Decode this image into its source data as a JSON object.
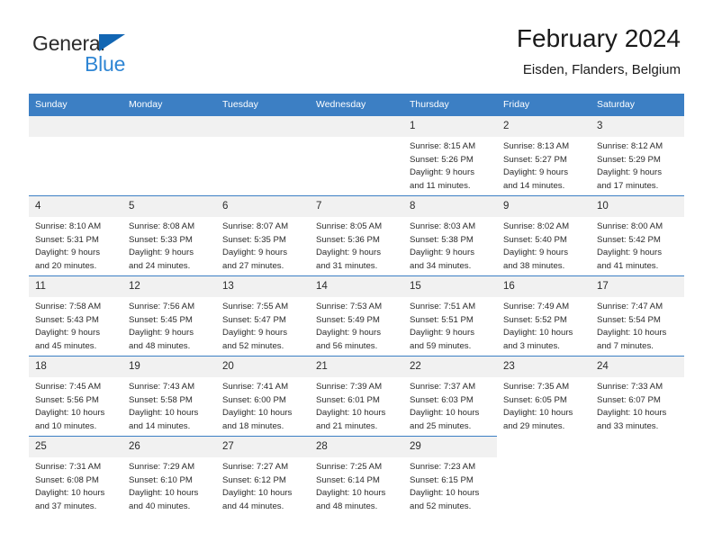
{
  "brand": {
    "line1": "General",
    "line2": "Blue",
    "triangle_icon": "blue-triangle-logo-mark",
    "accent_color": "#1266b3",
    "text_color": "#2f86d4"
  },
  "header": {
    "title": "February 2024",
    "subtitle": "Eisden, Flanders, Belgium"
  },
  "theme": {
    "header_row_bg": "#3c7fc4",
    "daynum_bg": "#f1f1f1",
    "text": "#2b2b2b"
  },
  "weekdays": [
    {
      "label": "Sunday"
    },
    {
      "label": "Monday"
    },
    {
      "label": "Tuesday"
    },
    {
      "label": "Wednesday"
    },
    {
      "label": "Thursday"
    },
    {
      "label": "Friday"
    },
    {
      "label": "Saturday"
    }
  ],
  "weeks": [
    [
      {
        "day": "",
        "empty": true,
        "sunrise": "",
        "sunset": "",
        "daylight1": "",
        "daylight2": ""
      },
      {
        "day": "",
        "empty": true,
        "sunrise": "",
        "sunset": "",
        "daylight1": "",
        "daylight2": ""
      },
      {
        "day": "",
        "empty": true,
        "sunrise": "",
        "sunset": "",
        "daylight1": "",
        "daylight2": ""
      },
      {
        "day": "",
        "empty": true,
        "sunrise": "",
        "sunset": "",
        "daylight1": "",
        "daylight2": ""
      },
      {
        "day": "1",
        "empty": false,
        "sunrise": "Sunrise: 8:15 AM",
        "sunset": "Sunset: 5:26 PM",
        "daylight1": "Daylight: 9 hours",
        "daylight2": "and 11 minutes."
      },
      {
        "day": "2",
        "empty": false,
        "sunrise": "Sunrise: 8:13 AM",
        "sunset": "Sunset: 5:27 PM",
        "daylight1": "Daylight: 9 hours",
        "daylight2": "and 14 minutes."
      },
      {
        "day": "3",
        "empty": false,
        "sunrise": "Sunrise: 8:12 AM",
        "sunset": "Sunset: 5:29 PM",
        "daylight1": "Daylight: 9 hours",
        "daylight2": "and 17 minutes."
      }
    ],
    [
      {
        "day": "4",
        "empty": false,
        "sunrise": "Sunrise: 8:10 AM",
        "sunset": "Sunset: 5:31 PM",
        "daylight1": "Daylight: 9 hours",
        "daylight2": "and 20 minutes."
      },
      {
        "day": "5",
        "empty": false,
        "sunrise": "Sunrise: 8:08 AM",
        "sunset": "Sunset: 5:33 PM",
        "daylight1": "Daylight: 9 hours",
        "daylight2": "and 24 minutes."
      },
      {
        "day": "6",
        "empty": false,
        "sunrise": "Sunrise: 8:07 AM",
        "sunset": "Sunset: 5:35 PM",
        "daylight1": "Daylight: 9 hours",
        "daylight2": "and 27 minutes."
      },
      {
        "day": "7",
        "empty": false,
        "sunrise": "Sunrise: 8:05 AM",
        "sunset": "Sunset: 5:36 PM",
        "daylight1": "Daylight: 9 hours",
        "daylight2": "and 31 minutes."
      },
      {
        "day": "8",
        "empty": false,
        "sunrise": "Sunrise: 8:03 AM",
        "sunset": "Sunset: 5:38 PM",
        "daylight1": "Daylight: 9 hours",
        "daylight2": "and 34 minutes."
      },
      {
        "day": "9",
        "empty": false,
        "sunrise": "Sunrise: 8:02 AM",
        "sunset": "Sunset: 5:40 PM",
        "daylight1": "Daylight: 9 hours",
        "daylight2": "and 38 minutes."
      },
      {
        "day": "10",
        "empty": false,
        "sunrise": "Sunrise: 8:00 AM",
        "sunset": "Sunset: 5:42 PM",
        "daylight1": "Daylight: 9 hours",
        "daylight2": "and 41 minutes."
      }
    ],
    [
      {
        "day": "11",
        "empty": false,
        "sunrise": "Sunrise: 7:58 AM",
        "sunset": "Sunset: 5:43 PM",
        "daylight1": "Daylight: 9 hours",
        "daylight2": "and 45 minutes."
      },
      {
        "day": "12",
        "empty": false,
        "sunrise": "Sunrise: 7:56 AM",
        "sunset": "Sunset: 5:45 PM",
        "daylight1": "Daylight: 9 hours",
        "daylight2": "and 48 minutes."
      },
      {
        "day": "13",
        "empty": false,
        "sunrise": "Sunrise: 7:55 AM",
        "sunset": "Sunset: 5:47 PM",
        "daylight1": "Daylight: 9 hours",
        "daylight2": "and 52 minutes."
      },
      {
        "day": "14",
        "empty": false,
        "sunrise": "Sunrise: 7:53 AM",
        "sunset": "Sunset: 5:49 PM",
        "daylight1": "Daylight: 9 hours",
        "daylight2": "and 56 minutes."
      },
      {
        "day": "15",
        "empty": false,
        "sunrise": "Sunrise: 7:51 AM",
        "sunset": "Sunset: 5:51 PM",
        "daylight1": "Daylight: 9 hours",
        "daylight2": "and 59 minutes."
      },
      {
        "day": "16",
        "empty": false,
        "sunrise": "Sunrise: 7:49 AM",
        "sunset": "Sunset: 5:52 PM",
        "daylight1": "Daylight: 10 hours",
        "daylight2": "and 3 minutes."
      },
      {
        "day": "17",
        "empty": false,
        "sunrise": "Sunrise: 7:47 AM",
        "sunset": "Sunset: 5:54 PM",
        "daylight1": "Daylight: 10 hours",
        "daylight2": "and 7 minutes."
      }
    ],
    [
      {
        "day": "18",
        "empty": false,
        "sunrise": "Sunrise: 7:45 AM",
        "sunset": "Sunset: 5:56 PM",
        "daylight1": "Daylight: 10 hours",
        "daylight2": "and 10 minutes."
      },
      {
        "day": "19",
        "empty": false,
        "sunrise": "Sunrise: 7:43 AM",
        "sunset": "Sunset: 5:58 PM",
        "daylight1": "Daylight: 10 hours",
        "daylight2": "and 14 minutes."
      },
      {
        "day": "20",
        "empty": false,
        "sunrise": "Sunrise: 7:41 AM",
        "sunset": "Sunset: 6:00 PM",
        "daylight1": "Daylight: 10 hours",
        "daylight2": "and 18 minutes."
      },
      {
        "day": "21",
        "empty": false,
        "sunrise": "Sunrise: 7:39 AM",
        "sunset": "Sunset: 6:01 PM",
        "daylight1": "Daylight: 10 hours",
        "daylight2": "and 21 minutes."
      },
      {
        "day": "22",
        "empty": false,
        "sunrise": "Sunrise: 7:37 AM",
        "sunset": "Sunset: 6:03 PM",
        "daylight1": "Daylight: 10 hours",
        "daylight2": "and 25 minutes."
      },
      {
        "day": "23",
        "empty": false,
        "sunrise": "Sunrise: 7:35 AM",
        "sunset": "Sunset: 6:05 PM",
        "daylight1": "Daylight: 10 hours",
        "daylight2": "and 29 minutes."
      },
      {
        "day": "24",
        "empty": false,
        "sunrise": "Sunrise: 7:33 AM",
        "sunset": "Sunset: 6:07 PM",
        "daylight1": "Daylight: 10 hours",
        "daylight2": "and 33 minutes."
      }
    ],
    [
      {
        "day": "25",
        "empty": false,
        "sunrise": "Sunrise: 7:31 AM",
        "sunset": "Sunset: 6:08 PM",
        "daylight1": "Daylight: 10 hours",
        "daylight2": "and 37 minutes."
      },
      {
        "day": "26",
        "empty": false,
        "sunrise": "Sunrise: 7:29 AM",
        "sunset": "Sunset: 6:10 PM",
        "daylight1": "Daylight: 10 hours",
        "daylight2": "and 40 minutes."
      },
      {
        "day": "27",
        "empty": false,
        "sunrise": "Sunrise: 7:27 AM",
        "sunset": "Sunset: 6:12 PM",
        "daylight1": "Daylight: 10 hours",
        "daylight2": "and 44 minutes."
      },
      {
        "day": "28",
        "empty": false,
        "sunrise": "Sunrise: 7:25 AM",
        "sunset": "Sunset: 6:14 PM",
        "daylight1": "Daylight: 10 hours",
        "daylight2": "and 48 minutes."
      },
      {
        "day": "29",
        "empty": false,
        "sunrise": "Sunrise: 7:23 AM",
        "sunset": "Sunset: 6:15 PM",
        "daylight1": "Daylight: 10 hours",
        "daylight2": "and 52 minutes."
      },
      {
        "day": "",
        "empty": true,
        "sunrise": "",
        "sunset": "",
        "daylight1": "",
        "daylight2": "",
        "blank": true
      },
      {
        "day": "",
        "empty": true,
        "sunrise": "",
        "sunset": "",
        "daylight1": "",
        "daylight2": "",
        "blank": true
      }
    ]
  ]
}
